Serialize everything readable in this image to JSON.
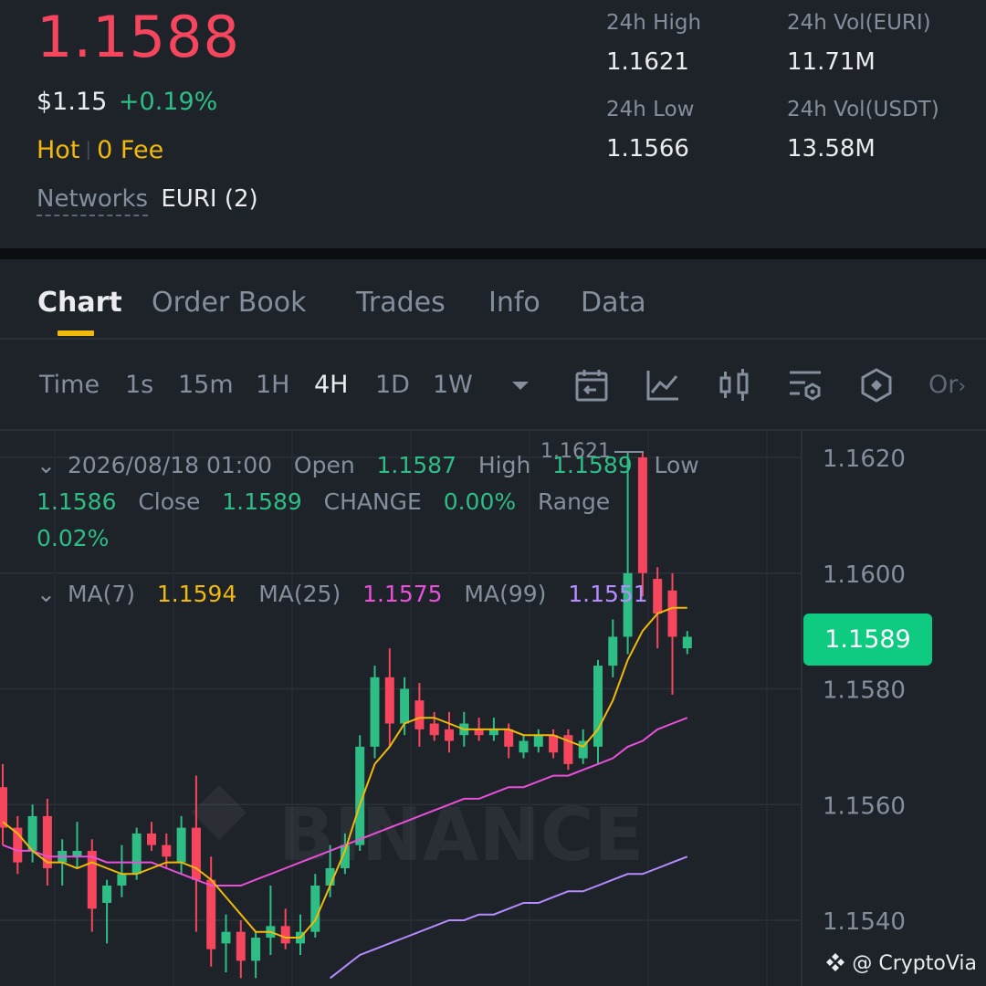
{
  "ticker": {
    "last_price": "1.1588",
    "usd_price": "$1.15",
    "change_pct": "+0.19%",
    "tag_hot": "Hot",
    "tag_separator": "|",
    "tag_fee": "0 Fee",
    "networks_label": "Networks",
    "networks_value": "EURI (2)"
  },
  "stats": {
    "high_label": "24h High",
    "high_value": "1.1621",
    "vol_base_label": "24h Vol(EURI)",
    "vol_base_value": "11.71M",
    "low_label": "24h Low",
    "low_value": "1.1566",
    "vol_quote_label": "24h Vol(USDT)",
    "vol_quote_value": "13.58M"
  },
  "tabs": [
    {
      "label": "Chart",
      "active": true
    },
    {
      "label": "Order Book",
      "active": false
    },
    {
      "label": "Trades",
      "active": false
    },
    {
      "label": "Info",
      "active": false
    },
    {
      "label": "Data",
      "active": false
    }
  ],
  "toolbar": {
    "time_label": "Time",
    "intervals": [
      "1s",
      "15m",
      "1H",
      "4H",
      "1D",
      "1W"
    ],
    "active_interval": "4H",
    "icons": [
      "chevron-down-icon",
      "calendar-icon",
      "indicator-icon",
      "candle-type-icon",
      "settings-icon",
      "hexagon-icon"
    ],
    "more": "Or"
  },
  "ohlc": {
    "date": "2026/08/18 01:00",
    "open_label": "Open",
    "open": "1.1587",
    "high_label": "High",
    "high": "1.1589",
    "low_label": "Low",
    "low": "1.1586",
    "close_label": "Close",
    "close": "1.1589",
    "change_label": "CHANGE",
    "change": "0.00%",
    "range_label": "Range",
    "range": "0.02%"
  },
  "ma": {
    "ma7_label": "MA(7)",
    "ma7": "1.1594",
    "ma25_label": "MA(25)",
    "ma25": "1.1575",
    "ma99_label": "MA(99)",
    "ma99": "1.1551"
  },
  "current_price_tag": "1.1589",
  "high_marker": "1.1621",
  "watermark": "BINANCE",
  "credit": "@ CryptoVia",
  "colors": {
    "up": "#2ebd85",
    "down": "#f6465d",
    "ma7": "#f0b90b",
    "ma25": "#e94fd9",
    "ma99": "#b58cff",
    "accent": "#f0b90b"
  },
  "chart_data": {
    "type": "candlestick",
    "y_ticks": [
      "1.1620",
      "1.1600",
      "1.1580",
      "1.1560",
      "1.1540"
    ],
    "ylim": [
      1.1532,
      1.1626
    ],
    "grid": true,
    "candles": [
      {
        "o": 1.1563,
        "h": 1.1567,
        "l": 1.1553,
        "c": 1.1556
      },
      {
        "o": 1.1556,
        "h": 1.1558,
        "l": 1.1548,
        "c": 1.155
      },
      {
        "o": 1.1552,
        "h": 1.156,
        "l": 1.155,
        "c": 1.1558
      },
      {
        "o": 1.1558,
        "h": 1.1561,
        "l": 1.1546,
        "c": 1.1549
      },
      {
        "o": 1.155,
        "h": 1.1554,
        "l": 1.1546,
        "c": 1.1552
      },
      {
        "o": 1.1551,
        "h": 1.1557,
        "l": 1.1549,
        "c": 1.1552
      },
      {
        "o": 1.1552,
        "h": 1.1554,
        "l": 1.1538,
        "c": 1.1542
      },
      {
        "o": 1.1543,
        "h": 1.1547,
        "l": 1.1536,
        "c": 1.1546
      },
      {
        "o": 1.1546,
        "h": 1.1553,
        "l": 1.1544,
        "c": 1.1548
      },
      {
        "o": 1.1548,
        "h": 1.1556,
        "l": 1.1547,
        "c": 1.1555
      },
      {
        "o": 1.1555,
        "h": 1.1557,
        "l": 1.1552,
        "c": 1.1553
      },
      {
        "o": 1.1553,
        "h": 1.1555,
        "l": 1.1549,
        "c": 1.1551
      },
      {
        "o": 1.155,
        "h": 1.1558,
        "l": 1.1548,
        "c": 1.1556
      },
      {
        "o": 1.1556,
        "h": 1.1565,
        "l": 1.1538,
        "c": 1.1547
      },
      {
        "o": 1.1547,
        "h": 1.1551,
        "l": 1.1532,
        "c": 1.1535
      },
      {
        "o": 1.1536,
        "h": 1.1541,
        "l": 1.1531,
        "c": 1.1538
      },
      {
        "o": 1.1538,
        "h": 1.154,
        "l": 1.153,
        "c": 1.1533
      },
      {
        "o": 1.1533,
        "h": 1.1538,
        "l": 1.153,
        "c": 1.1537
      },
      {
        "o": 1.1537,
        "h": 1.1546,
        "l": 1.1534,
        "c": 1.1539
      },
      {
        "o": 1.1539,
        "h": 1.1542,
        "l": 1.1535,
        "c": 1.1536
      },
      {
        "o": 1.1536,
        "h": 1.1541,
        "l": 1.1534,
        "c": 1.1538
      },
      {
        "o": 1.1538,
        "h": 1.1548,
        "l": 1.1537,
        "c": 1.1546
      },
      {
        "o": 1.1546,
        "h": 1.1553,
        "l": 1.1544,
        "c": 1.1549
      },
      {
        "o": 1.1549,
        "h": 1.1555,
        "l": 1.1548,
        "c": 1.1553
      },
      {
        "o": 1.1553,
        "h": 1.1572,
        "l": 1.1552,
        "c": 1.157
      },
      {
        "o": 1.157,
        "h": 1.1584,
        "l": 1.1568,
        "c": 1.1582
      },
      {
        "o": 1.1582,
        "h": 1.1587,
        "l": 1.157,
        "c": 1.1574
      },
      {
        "o": 1.1574,
        "h": 1.1582,
        "l": 1.1572,
        "c": 1.158
      },
      {
        "o": 1.1578,
        "h": 1.1581,
        "l": 1.157,
        "c": 1.1573
      },
      {
        "o": 1.1574,
        "h": 1.1576,
        "l": 1.1571,
        "c": 1.1572
      },
      {
        "o": 1.1573,
        "h": 1.1576,
        "l": 1.1569,
        "c": 1.1571
      },
      {
        "o": 1.1572,
        "h": 1.1576,
        "l": 1.157,
        "c": 1.1574
      },
      {
        "o": 1.1573,
        "h": 1.1575,
        "l": 1.1571,
        "c": 1.1572
      },
      {
        "o": 1.1572,
        "h": 1.1575,
        "l": 1.1571,
        "c": 1.1573
      },
      {
        "o": 1.1573,
        "h": 1.1574,
        "l": 1.1568,
        "c": 1.157
      },
      {
        "o": 1.1569,
        "h": 1.1572,
        "l": 1.1568,
        "c": 1.1571
      },
      {
        "o": 1.157,
        "h": 1.1573,
        "l": 1.1569,
        "c": 1.1572
      },
      {
        "o": 1.1572,
        "h": 1.1573,
        "l": 1.1568,
        "c": 1.1569
      },
      {
        "o": 1.1572,
        "h": 1.1573,
        "l": 1.1566,
        "c": 1.1567
      },
      {
        "o": 1.1568,
        "h": 1.1573,
        "l": 1.1567,
        "c": 1.1571
      },
      {
        "o": 1.157,
        "h": 1.1585,
        "l": 1.1567,
        "c": 1.1584
      },
      {
        "o": 1.1584,
        "h": 1.1592,
        "l": 1.1582,
        "c": 1.1589
      },
      {
        "o": 1.1589,
        "h": 1.1621,
        "l": 1.1586,
        "c": 1.16
      },
      {
        "o": 1.162,
        "h": 1.1621,
        "l": 1.1596,
        "c": 1.16
      },
      {
        "o": 1.1599,
        "h": 1.1601,
        "l": 1.1587,
        "c": 1.1593
      },
      {
        "o": 1.1597,
        "h": 1.16,
        "l": 1.1579,
        "c": 1.1589
      },
      {
        "o": 1.1587,
        "h": 1.159,
        "l": 1.1586,
        "c": 1.1589
      }
    ],
    "ma7": [
      1.1557,
      1.1555,
      1.1552,
      1.155,
      1.155,
      1.1549,
      1.155,
      1.1549,
      1.1548,
      1.1548,
      1.1549,
      1.155,
      1.155,
      1.1549,
      1.1547,
      1.1544,
      1.1541,
      1.1538,
      1.1538,
      1.1537,
      1.1537,
      1.154,
      1.1546,
      1.1552,
      1.156,
      1.1567,
      1.157,
      1.1574,
      1.1575,
      1.1575,
      1.1574,
      1.1573,
      1.1573,
      1.1573,
      1.1573,
      1.1572,
      1.1572,
      1.1572,
      1.1571,
      1.157,
      1.1573,
      1.1578,
      1.1585,
      1.159,
      1.1593,
      1.1594,
      1.1594
    ],
    "ma25": [
      1.1553,
      1.1552,
      1.1552,
      1.1551,
      1.1551,
      1.1551,
      1.1551,
      1.155,
      1.155,
      1.155,
      1.155,
      1.1549,
      1.1548,
      1.1547,
      1.1546,
      1.1546,
      1.1546,
      1.1547,
      1.1548,
      1.1549,
      1.155,
      1.1551,
      1.1552,
      1.1553,
      1.1554,
      1.1555,
      1.1556,
      1.1557,
      1.1558,
      1.1559,
      1.156,
      1.1561,
      1.1561,
      1.1562,
      1.1563,
      1.1563,
      1.1564,
      1.1565,
      1.1565,
      1.1566,
      1.1567,
      1.1568,
      1.157,
      1.1571,
      1.1573,
      1.1574,
      1.1575
    ],
    "ma99": [
      null,
      null,
      null,
      null,
      null,
      null,
      null,
      null,
      null,
      null,
      null,
      null,
      null,
      null,
      null,
      null,
      null,
      null,
      null,
      null,
      null,
      null,
      1.153,
      1.1532,
      1.1534,
      1.1535,
      1.1536,
      1.1537,
      1.1538,
      1.1539,
      1.154,
      1.154,
      1.1541,
      1.1541,
      1.1542,
      1.1543,
      1.1543,
      1.1544,
      1.1545,
      1.1545,
      1.1546,
      1.1547,
      1.1548,
      1.1548,
      1.1549,
      1.155,
      1.1551
    ]
  }
}
